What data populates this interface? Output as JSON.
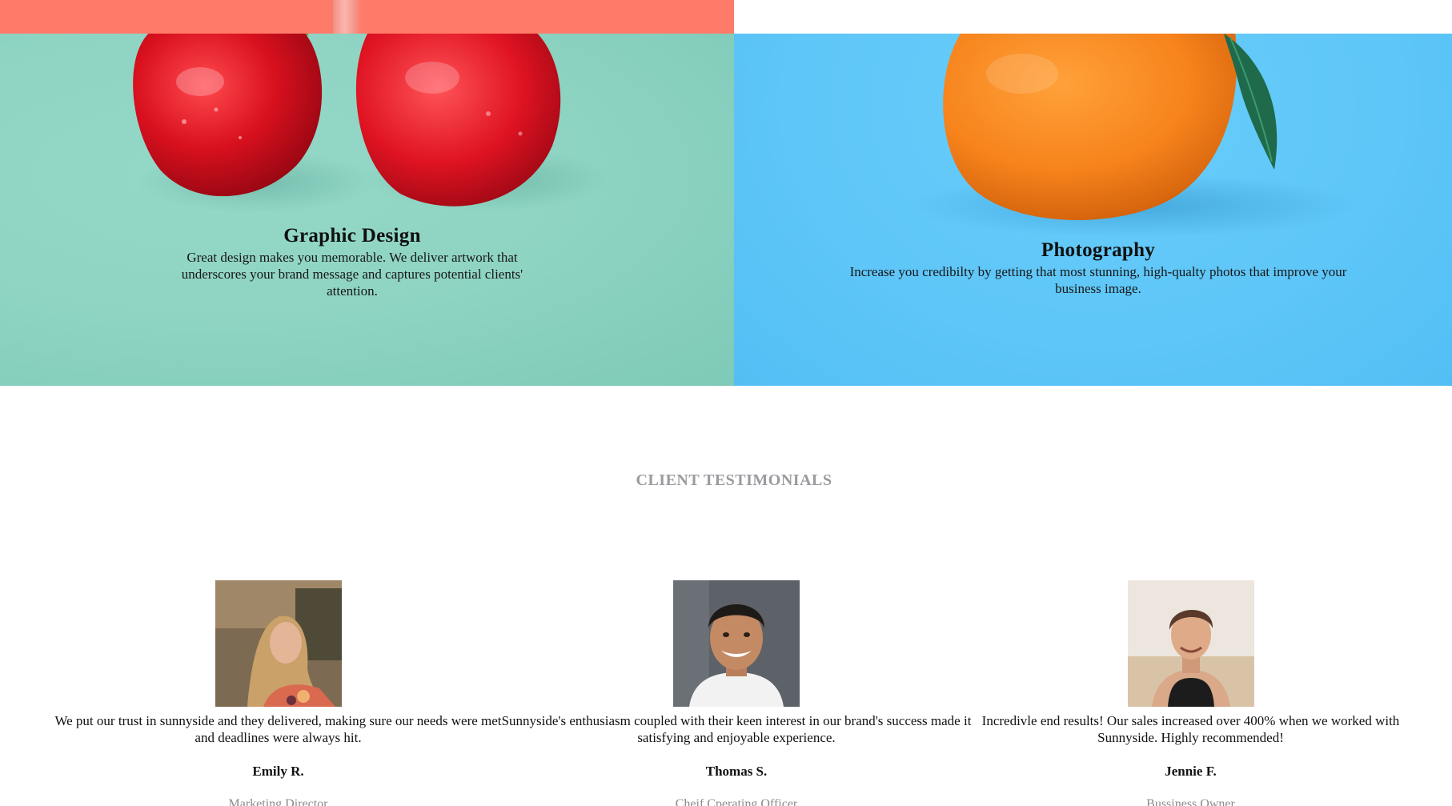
{
  "services": {
    "graphic_design": {
      "title": "Graphic Design",
      "description": "Great design makes you memorable. We deliver artwork that underscores your brand message and captures potential clients' attention.",
      "image": "cherries-photo",
      "background_color": "#8fd4c3"
    },
    "photography": {
      "title": "Photography",
      "description": "Increase you credibilty by getting that most stunning, high-qualty photos that improve your business image.",
      "image": "orange-photo",
      "background_color": "#5ec6f8"
    }
  },
  "top_strip": {
    "color": "#fe7a69"
  },
  "testimonials": {
    "heading": "CLIENT TESTIMONIALS",
    "items": [
      {
        "quote": "We put our trust in sunnyside and they delivered, making sure our needs were met and deadlines were always hit.",
        "name": "Emily R.",
        "role": "Marketing Director",
        "avatar": "emily-avatar"
      },
      {
        "quote": "Sunnyside's enthusiasm coupled with their keen interest in our brand's success made it satisfying and enjoyable experience.",
        "name": "Thomas S.",
        "role": "Cheif Cperating Officer",
        "avatar": "thomas-avatar"
      },
      {
        "quote": "Incredivle end results! Our sales increased over 400% when we worked with Sunnyside. Highly recommended!",
        "name": "Jennie F.",
        "role": "Bussiness Owner",
        "avatar": "jennie-avatar"
      }
    ]
  }
}
